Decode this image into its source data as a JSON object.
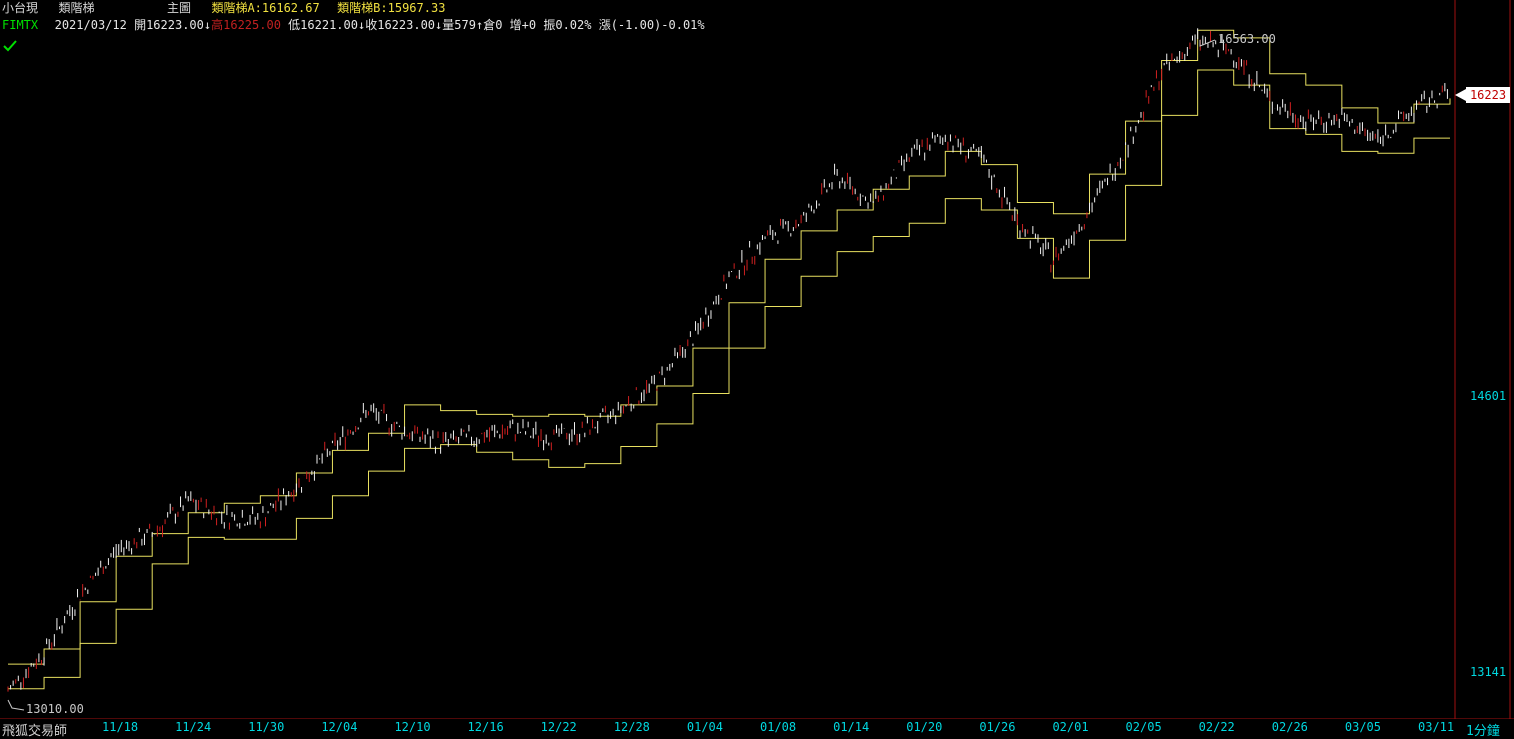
{
  "header": {
    "title": "小台現",
    "indicator_name": "類階梯",
    "pane_label": "主圖",
    "ind_a_label": "類階梯A:",
    "ind_a_value": "16162.67",
    "ind_b_label": "類階梯B:",
    "ind_b_value": "15967.33",
    "symbol": "FIMTX",
    "date": "2021/03/12",
    "open": "開16223.00",
    "open_arrow": "↓",
    "high": "高16225.00",
    "low": "低16221.00",
    "low_arrow": "↓",
    "close": "收16223.00",
    "close_arrow": "↓",
    "volume": "量579",
    "volume_arrow": "↑",
    "oi": "倉0",
    "oi_change": "增+0",
    "amplitude": "振0.02%",
    "change": "漲(-1.00)-0.01%"
  },
  "footer": {
    "brand": "飛狐交易師",
    "timeframe": "1分鐘"
  },
  "annotations": {
    "high_label": "16563.00",
    "low_label": "13010.00",
    "last_price": "16223"
  },
  "colors": {
    "background": "#000000",
    "step_lines": "#e8e060",
    "candles": "#f0f0f0",
    "candle_down": "#d02020",
    "axis_text": "#00d8e0",
    "axis_line": "#a01010"
  },
  "chart_data": {
    "type": "line",
    "title": "小台現 類階梯",
    "x_ticks": [
      "11/18",
      "11/24",
      "11/30",
      "12/04",
      "12/10",
      "12/16",
      "12/22",
      "12/28",
      "01/04",
      "01/08",
      "01/14",
      "01/20",
      "01/26",
      "02/01",
      "02/05",
      "02/22",
      "02/26",
      "03/05",
      "03/11"
    ],
    "y_ticks": [
      13141,
      14601
    ],
    "ylim": [
      12900,
      16700
    ],
    "grid": false,
    "series": [
      {
        "name": "類階梯A",
        "x": [
          "11/12",
          "11/14",
          "11/16",
          "11/18",
          "11/20",
          "11/24",
          "11/26",
          "11/30",
          "12/02",
          "12/04",
          "12/08",
          "12/10",
          "12/14",
          "12/16",
          "12/18",
          "12/22",
          "12/24",
          "12/28",
          "12/30",
          "01/04",
          "01/06",
          "01/08",
          "01/12",
          "01/14",
          "01/18",
          "01/20",
          "01/22",
          "01/26",
          "01/28",
          "02/01",
          "02/03",
          "02/05",
          "02/19",
          "02/22",
          "02/24",
          "02/26",
          "03/02",
          "03/05",
          "03/09",
          "03/11",
          "03/12"
        ],
        "values": [
          13190,
          13270,
          13520,
          13760,
          13880,
          13990,
          14040,
          14080,
          14200,
          14320,
          14410,
          14560,
          14530,
          14510,
          14500,
          14510,
          14500,
          14560,
          14660,
          14860,
          15100,
          15330,
          15480,
          15590,
          15700,
          15770,
          15900,
          15830,
          15630,
          15570,
          15780,
          16060,
          16380,
          16540,
          16500,
          16310,
          16250,
          16130,
          16050,
          16150,
          16180
        ]
      },
      {
        "name": "類階梯B",
        "x": [
          "11/12",
          "11/14",
          "11/16",
          "11/18",
          "11/20",
          "11/24",
          "11/26",
          "11/30",
          "12/02",
          "12/04",
          "12/08",
          "12/10",
          "12/14",
          "12/16",
          "12/18",
          "12/22",
          "12/24",
          "12/28",
          "12/30",
          "01/04",
          "01/06",
          "01/08",
          "01/12",
          "01/14",
          "01/18",
          "01/20",
          "01/22",
          "01/26",
          "01/28",
          "02/01",
          "02/03",
          "02/05",
          "02/19",
          "02/22",
          "02/24",
          "02/26",
          "03/02",
          "03/05",
          "03/09",
          "03/11",
          "03/12"
        ],
        "values": [
          13060,
          13120,
          13300,
          13480,
          13720,
          13860,
          13850,
          13850,
          13960,
          14080,
          14210,
          14330,
          14350,
          14310,
          14270,
          14230,
          14250,
          14340,
          14460,
          14620,
          14860,
          15080,
          15240,
          15370,
          15450,
          15520,
          15650,
          15590,
          15440,
          15230,
          15430,
          15720,
          16090,
          16330,
          16250,
          16020,
          15990,
          15900,
          15890,
          15970,
          15970
        ]
      },
      {
        "name": "收盤",
        "x": [
          "11/12",
          "11/14",
          "11/16",
          "11/18",
          "11/20",
          "11/24",
          "11/26",
          "11/30",
          "12/02",
          "12/04",
          "12/08",
          "12/10",
          "12/14",
          "12/16",
          "12/18",
          "12/22",
          "12/24",
          "12/28",
          "12/30",
          "01/04",
          "01/06",
          "01/08",
          "01/12",
          "01/14",
          "01/18",
          "01/20",
          "01/22",
          "01/26",
          "01/28",
          "02/01",
          "02/03",
          "02/05",
          "02/19",
          "02/22",
          "02/24",
          "02/26",
          "03/02",
          "03/05",
          "03/09",
          "03/11",
          "03/12"
        ],
        "values": [
          13050,
          13250,
          13560,
          13790,
          13880,
          14050,
          13970,
          13960,
          14130,
          14330,
          14530,
          14420,
          14360,
          14390,
          14430,
          14390,
          14420,
          14540,
          14680,
          14910,
          15230,
          15440,
          15530,
          15770,
          15620,
          15870,
          15980,
          15860,
          15530,
          15320,
          15590,
          15920,
          16320,
          16490,
          16420,
          16170,
          16060,
          16070,
          15960,
          16120,
          16223
        ]
      }
    ]
  }
}
